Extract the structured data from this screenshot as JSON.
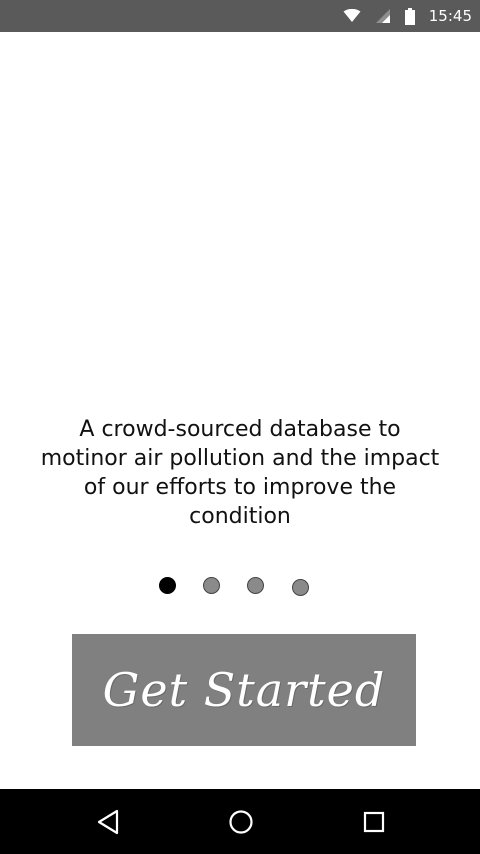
{
  "status_bar": {
    "time": "15:45",
    "icons": [
      "wifi-icon",
      "signal-icon",
      "battery-icon"
    ]
  },
  "onboarding": {
    "description": "A crowd-sourced database to motinor air pollution and the impact of our efforts to improve the condition",
    "page_indicator": {
      "total": 4,
      "active_index": 0
    },
    "cta_label": "Get Started"
  },
  "nav_bar": {
    "buttons": [
      "back-icon",
      "home-icon",
      "recents-icon"
    ]
  },
  "colors": {
    "status_bar": "#5a5a5a",
    "button": "#808080",
    "nav_bar": "#000000",
    "dot_active": "#000000",
    "dot_inactive": "#8a8a8a"
  }
}
